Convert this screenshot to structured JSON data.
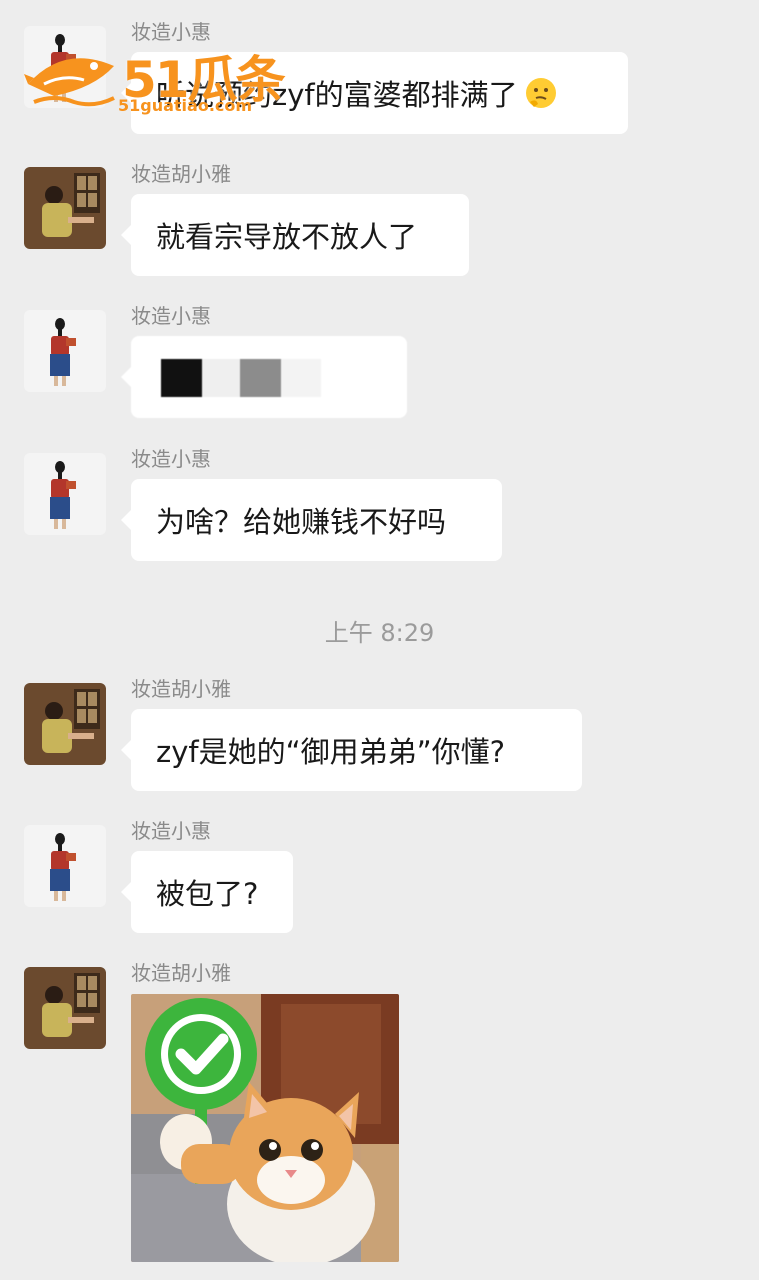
{
  "watermark": {
    "brand": "51瓜条",
    "domain": "51guatiao.com"
  },
  "messages": [
    {
      "sender": "妆造小惠",
      "text": "听说预约zyf的富婆都排满了",
      "emoji": "thinking-face"
    },
    {
      "sender": "妆造胡小雅",
      "text": "就看宗导放不放人了"
    },
    {
      "sender": "妆造小惠",
      "redacted": true
    },
    {
      "sender": "妆造小惠",
      "text": "为啥？给她赚钱不好吗"
    },
    {
      "sender": "妆造胡小雅",
      "text": "zyf是她的“御用弟弟”你懂?"
    },
    {
      "sender": "妆造小惠",
      "text": "被包了?"
    },
    {
      "sender": "妆造胡小雅",
      "sticker": "cat-holding-green-check-sign"
    }
  ],
  "timestamp": "上午 8:29",
  "colors": {
    "background": "#ededed",
    "bubble": "#ffffff",
    "sender": "#8a8a8a",
    "watermark": "#f7931e",
    "check_green": "#3db53d"
  }
}
